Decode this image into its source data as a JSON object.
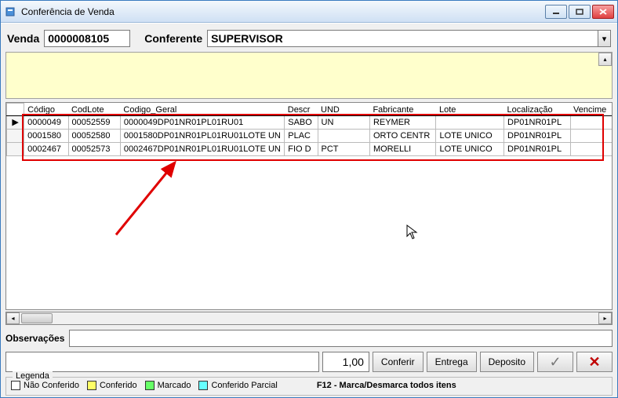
{
  "window": {
    "title": "Conferência de Venda"
  },
  "header": {
    "venda_label": "Venda",
    "venda_value": "0000008105",
    "conferente_label": "Conferente",
    "conferente_value": "SUPERVISOR"
  },
  "grid": {
    "columns": [
      "",
      "Código",
      "CodLote",
      "Codigo_Geral",
      "Descr",
      "UND",
      "Fabricante",
      "Lote",
      "Localização",
      "Vencime"
    ],
    "rows": [
      {
        "ptr": "▶",
        "codigo": "0000049",
        "codlote": "00052559",
        "codgeral": "0000049DP01NR01PL01RU01",
        "descr": "SABO",
        "und": "UN",
        "fab": "REYMER",
        "lote": "",
        "loc": "DP01NR01PL",
        "venc": ""
      },
      {
        "ptr": "",
        "codigo": "0001580",
        "codlote": "00052580",
        "codgeral": "0001580DP01NR01PL01RU01LOTE UN",
        "descr": "PLAC",
        "und": "",
        "fab": "ORTO CENTR",
        "lote": "LOTE UNICO",
        "loc": "DP01NR01PL",
        "venc": ""
      },
      {
        "ptr": "",
        "codigo": "0002467",
        "codlote": "00052573",
        "codgeral": "0002467DP01NR01PL01RU01LOTE UN",
        "descr": "FIO D",
        "und": "PCT",
        "fab": "MORELLI",
        "lote": "LOTE UNICO",
        "loc": "DP01NR01PL",
        "venc": ""
      }
    ]
  },
  "obs": {
    "label": "Observações",
    "value": ""
  },
  "action": {
    "code_value": "",
    "qty_value": "1,00",
    "conferir": "Conferir",
    "entrega": "Entrega",
    "deposito": "Deposito",
    "ok": "✓",
    "cancel": "✕"
  },
  "legend": {
    "title": "Legenda",
    "nao": "Não Conferido",
    "conf": "Conferido",
    "marc": "Marcado",
    "parc": "Conferido Parcial",
    "f12": "F12 - Marca/Desmarca todos itens"
  }
}
